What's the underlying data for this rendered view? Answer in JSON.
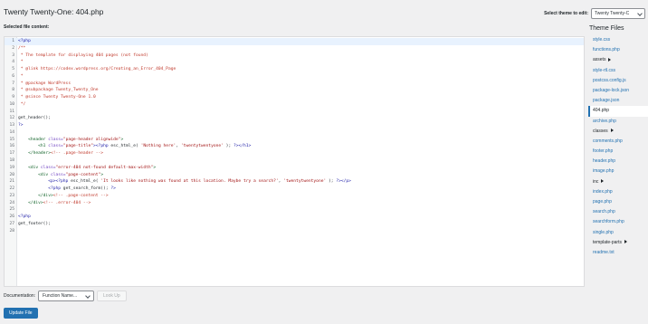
{
  "header": {
    "title": "Twenty Twenty-One: 404.php",
    "selected_file_label": "Selected file content:",
    "theme_select_label": "Select theme to edit:",
    "theme_select_value": "Twenty Twenty-C"
  },
  "sidebar": {
    "title": "Theme Files",
    "files": [
      {
        "label": "style.css",
        "kind": "file"
      },
      {
        "label": "functions.php",
        "kind": "file"
      },
      {
        "label": "assets",
        "kind": "folder"
      },
      {
        "label": "style-rtl.css",
        "kind": "file"
      },
      {
        "label": "postcss.config.js",
        "kind": "file"
      },
      {
        "label": "package-lock.json",
        "kind": "file"
      },
      {
        "label": "package.json",
        "kind": "file"
      },
      {
        "label": "404.php",
        "kind": "current"
      },
      {
        "label": "archive.php",
        "kind": "file"
      },
      {
        "label": "classes",
        "kind": "folder"
      },
      {
        "label": "comments.php",
        "kind": "file"
      },
      {
        "label": "footer.php",
        "kind": "file"
      },
      {
        "label": "header.php",
        "kind": "file"
      },
      {
        "label": "image.php",
        "kind": "file"
      },
      {
        "label": "inc",
        "kind": "folder"
      },
      {
        "label": "index.php",
        "kind": "file"
      },
      {
        "label": "page.php",
        "kind": "file"
      },
      {
        "label": "search.php",
        "kind": "file"
      },
      {
        "label": "searchform.php",
        "kind": "file"
      },
      {
        "label": "single.php",
        "kind": "file"
      },
      {
        "label": "template-parts",
        "kind": "folder"
      },
      {
        "label": "readme.txt",
        "kind": "file"
      }
    ]
  },
  "editor": {
    "lines": [
      {
        "n": "1",
        "active": true,
        "parts": [
          {
            "t": "<?php",
            "c": "kw"
          }
        ]
      },
      {
        "n": "2",
        "parts": [
          {
            "t": "/**",
            "c": "cm"
          }
        ]
      },
      {
        "n": "3",
        "parts": [
          {
            "t": " * The template for displaying 404 pages (not found)",
            "c": "cm"
          }
        ]
      },
      {
        "n": "4",
        "parts": [
          {
            "t": " *",
            "c": "cm"
          }
        ]
      },
      {
        "n": "5",
        "parts": [
          {
            "t": " * @link https://codex.wordpress.org/Creating_an_Error_404_Page",
            "c": "cm"
          }
        ]
      },
      {
        "n": "6",
        "parts": [
          {
            "t": " *",
            "c": "cm"
          }
        ]
      },
      {
        "n": "7",
        "parts": [
          {
            "t": " * @package WordPress",
            "c": "cm"
          }
        ]
      },
      {
        "n": "8",
        "parts": [
          {
            "t": " * @subpackage Twenty_Twenty_One",
            "c": "cm"
          }
        ]
      },
      {
        "n": "9",
        "parts": [
          {
            "t": " * @since Twenty Twenty-One 1.0",
            "c": "cm"
          }
        ]
      },
      {
        "n": "10",
        "parts": [
          {
            "t": " */",
            "c": "cm"
          }
        ]
      },
      {
        "n": "11",
        "parts": []
      },
      {
        "n": "12",
        "parts": [
          {
            "t": "get_header();",
            "c": "df"
          }
        ]
      },
      {
        "n": "13",
        "parts": [
          {
            "t": "?>",
            "c": "kw"
          }
        ]
      },
      {
        "n": "14",
        "parts": []
      },
      {
        "n": "15",
        "parts": [
          {
            "t": "    <header ",
            "c": "tag"
          },
          {
            "t": "class=",
            "c": "at"
          },
          {
            "t": "\"page-header alignwide\"",
            "c": "st"
          },
          {
            "t": ">",
            "c": "tag"
          }
        ]
      },
      {
        "n": "16",
        "parts": [
          {
            "t": "        <h1 ",
            "c": "tag"
          },
          {
            "t": "class=",
            "c": "at"
          },
          {
            "t": "\"page-title\"",
            "c": "st"
          },
          {
            "t": "><?php ",
            "c": "kw"
          },
          {
            "t": "esc_html_e( ",
            "c": "df"
          },
          {
            "t": "'Nothing here'",
            "c": "st"
          },
          {
            "t": ", ",
            "c": "df"
          },
          {
            "t": "'twentytwentyone'",
            "c": "st"
          },
          {
            "t": " ); ",
            "c": "df"
          },
          {
            "t": "?></h1>",
            "c": "kw"
          }
        ]
      },
      {
        "n": "17",
        "parts": [
          {
            "t": "    </header>",
            "c": "tag"
          },
          {
            "t": "<!-- .page-header -->",
            "c": "cm"
          }
        ]
      },
      {
        "n": "18",
        "parts": []
      },
      {
        "n": "19",
        "parts": [
          {
            "t": "    <div ",
            "c": "tag"
          },
          {
            "t": "class=",
            "c": "at"
          },
          {
            "t": "\"error-404 not-found default-max-width\"",
            "c": "st"
          },
          {
            "t": ">",
            "c": "tag"
          }
        ]
      },
      {
        "n": "20",
        "parts": [
          {
            "t": "        <div ",
            "c": "tag"
          },
          {
            "t": "class=",
            "c": "at"
          },
          {
            "t": "\"page-content\"",
            "c": "st"
          },
          {
            "t": ">",
            "c": "tag"
          }
        ]
      },
      {
        "n": "21",
        "parts": [
          {
            "t": "            <p><?php ",
            "c": "kw"
          },
          {
            "t": "esc_html_e( ",
            "c": "df"
          },
          {
            "t": "'It looks like nothing was found at this location. Maybe try a search?'",
            "c": "st"
          },
          {
            "t": ", ",
            "c": "df"
          },
          {
            "t": "'twentytwentyone'",
            "c": "st"
          },
          {
            "t": " ); ",
            "c": "df"
          },
          {
            "t": "?></p>",
            "c": "kw"
          }
        ]
      },
      {
        "n": "22",
        "parts": [
          {
            "t": "            <?php ",
            "c": "kw"
          },
          {
            "t": "get_search_form(); ",
            "c": "df"
          },
          {
            "t": "?>",
            "c": "kw"
          }
        ]
      },
      {
        "n": "23",
        "parts": [
          {
            "t": "        </div>",
            "c": "tag"
          },
          {
            "t": "<!-- .page-content -->",
            "c": "cm"
          }
        ]
      },
      {
        "n": "24",
        "parts": [
          {
            "t": "    </div>",
            "c": "tag"
          },
          {
            "t": "<!-- .error-404 -->",
            "c": "cm"
          }
        ]
      },
      {
        "n": "25",
        "parts": []
      },
      {
        "n": "26",
        "parts": [
          {
            "t": "<?php",
            "c": "kw"
          }
        ]
      },
      {
        "n": "27",
        "parts": [
          {
            "t": "get_footer();",
            "c": "df"
          }
        ]
      },
      {
        "n": "28",
        "parts": []
      }
    ]
  },
  "footer": {
    "documentation_label": "Documentation:",
    "function_select_value": "Function Name...",
    "lookup_label": "Look Up",
    "update_label": "Update File"
  },
  "colors": {
    "accent": "#2271b1",
    "background": "#f0f0f1"
  }
}
